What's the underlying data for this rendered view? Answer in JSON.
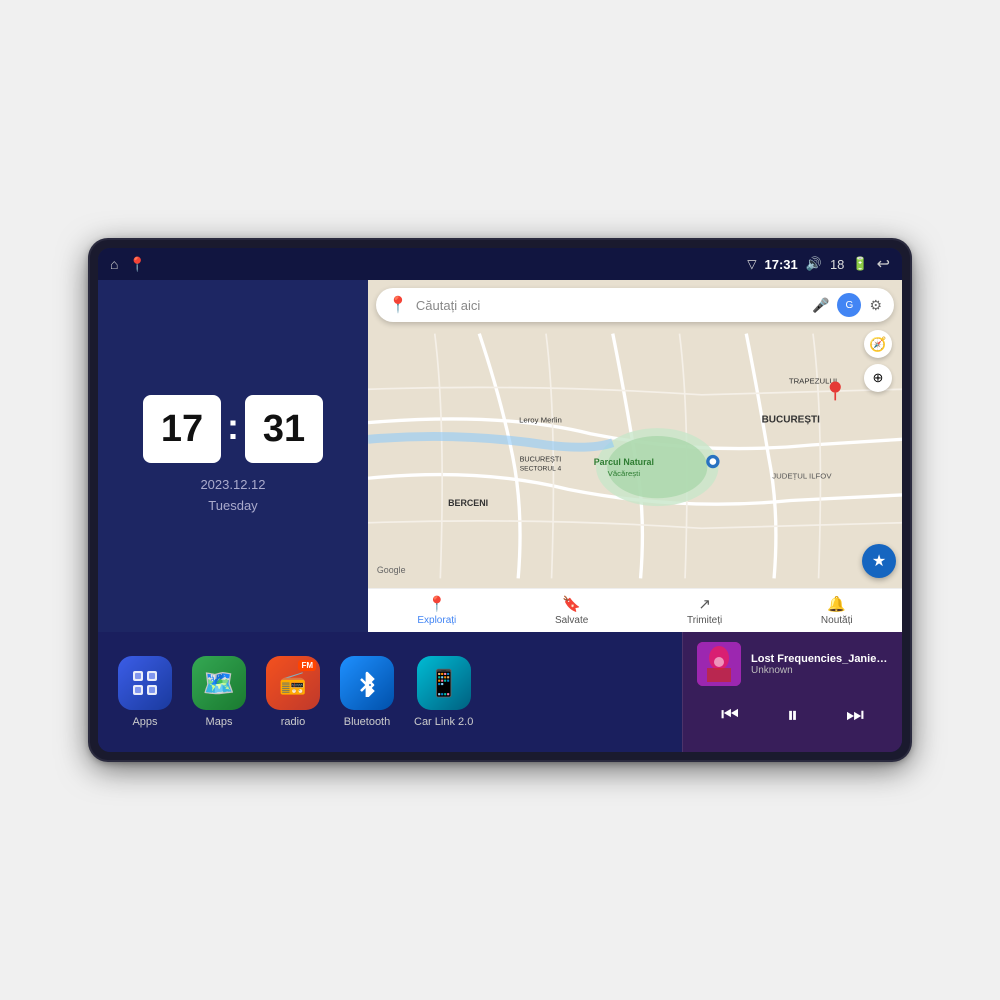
{
  "device": {
    "status_bar": {
      "left_icons": [
        "home",
        "maps"
      ],
      "time": "17:31",
      "signal": "▽",
      "volume": "🔊",
      "battery_level": "18",
      "battery_icon": "🔋",
      "back_icon": "↩"
    },
    "clock": {
      "hour": "17",
      "minute": "31",
      "date": "2023.12.12",
      "day": "Tuesday"
    },
    "map": {
      "search_placeholder": "Căutați aici",
      "locations": [
        "Parcul Natural Văcărești",
        "BUCUREȘTI",
        "JUDEȚUL ILFOV",
        "TRAPEZULUI",
        "Leroy Merlin",
        "BUCUREȘTI SECTORUL 4",
        "BERCENI"
      ],
      "nav_items": [
        {
          "label": "Explorați",
          "active": true
        },
        {
          "label": "Salvate",
          "active": false
        },
        {
          "label": "Trimiteți",
          "active": false
        },
        {
          "label": "Noutăți",
          "active": false
        }
      ]
    },
    "apps": [
      {
        "id": "apps",
        "label": "Apps",
        "bg": "apps-bg"
      },
      {
        "id": "maps",
        "label": "Maps",
        "bg": "maps-bg"
      },
      {
        "id": "radio",
        "label": "radio",
        "bg": "radio-bg"
      },
      {
        "id": "bluetooth",
        "label": "Bluetooth",
        "bg": "bt-bg"
      },
      {
        "id": "carlink",
        "label": "Car Link 2.0",
        "bg": "carlink-bg"
      }
    ],
    "media": {
      "title": "Lost Frequencies_Janieck Devy-...",
      "artist": "Unknown",
      "prev_label": "⏮",
      "play_label": "⏸",
      "next_label": "⏭"
    }
  }
}
